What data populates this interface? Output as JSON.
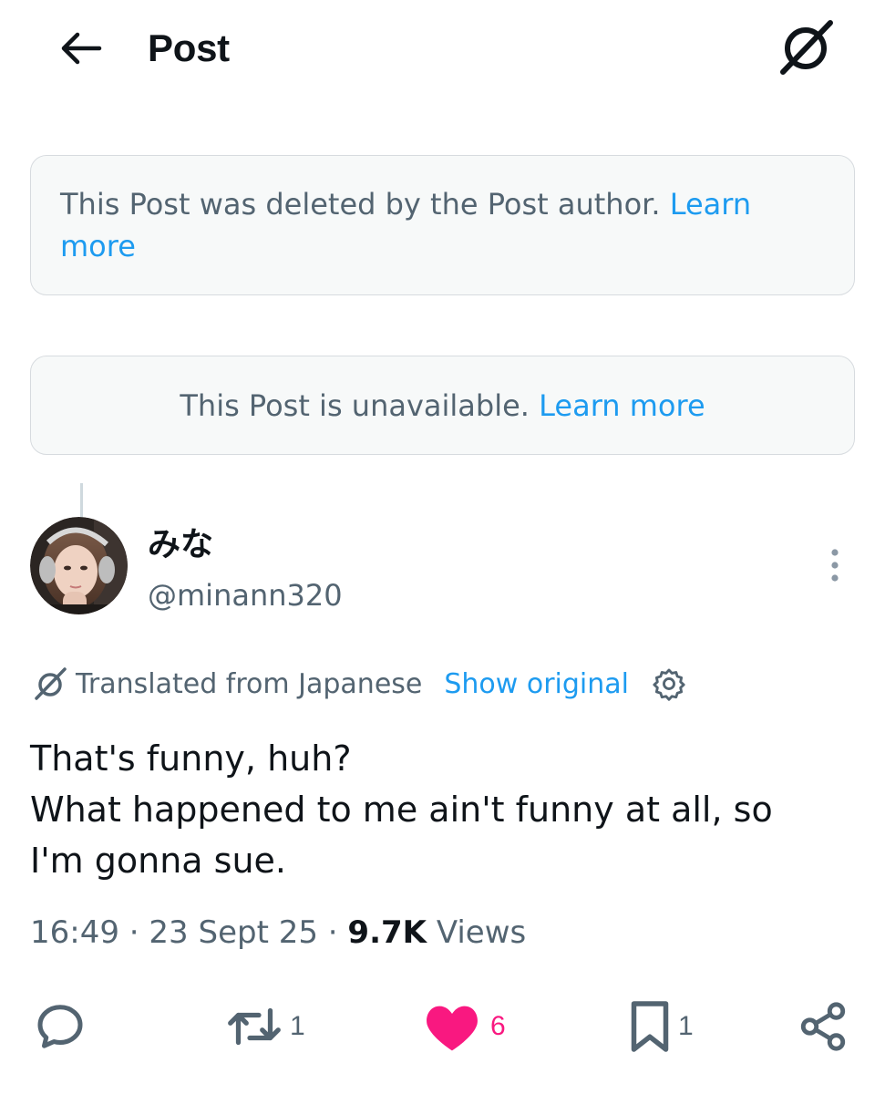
{
  "header": {
    "title": "Post",
    "back_icon": "arrow-left-icon",
    "grok_icon": "grok-icon"
  },
  "notices": {
    "deleted": {
      "text": "This Post was deleted by the Post author.",
      "link": "Learn more"
    },
    "unavailable": {
      "text": "This Post is unavailable.",
      "link": "Learn more"
    }
  },
  "post": {
    "author": {
      "display_name": "みな",
      "handle": "@minann320"
    },
    "translation": {
      "label": "Translated from Japanese",
      "show_original": "Show original"
    },
    "text_lines": [
      "That's funny, huh?",
      "What happened to me ain't funny at all, so",
      "I'm gonna sue."
    ],
    "meta": {
      "time": "16:49",
      "sep": "·",
      "date": "23 Sept 25",
      "views_count": "9.7K",
      "views_label": "Views"
    },
    "actions": {
      "reply": "",
      "retweets": "1",
      "likes": "6",
      "bookmarks": "1"
    }
  },
  "colors": {
    "accent": "#1d9bf0",
    "like": "#f91880",
    "secondary_text": "#536471",
    "notice_bg": "#f7f9f9",
    "notice_border": "#d7dbdf"
  }
}
